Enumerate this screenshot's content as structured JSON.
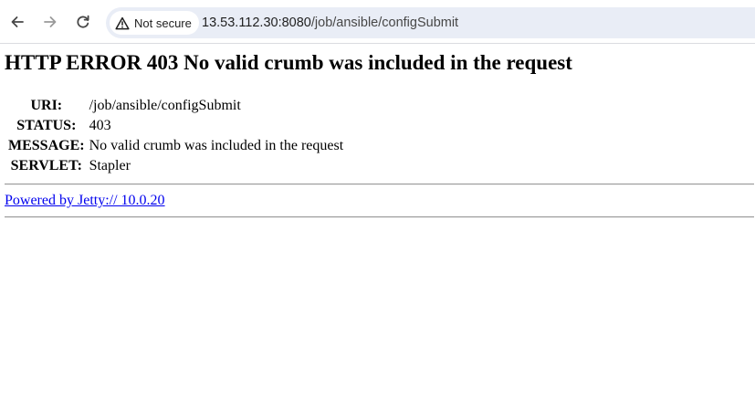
{
  "browser": {
    "back_icon": "arrow-left-icon",
    "forward_icon": "arrow-right-icon",
    "reload_icon": "reload-icon",
    "security_icon": "warning-triangle-icon",
    "security_label": "Not secure",
    "url_host": "13.53.112.30:8080",
    "url_path": "/job/ansible/configSubmit"
  },
  "page": {
    "title": "HTTP ERROR 403 No valid crumb was included in the request",
    "rows": [
      {
        "label": "URI:",
        "value": "/job/ansible/configSubmit"
      },
      {
        "label": "STATUS:",
        "value": "403"
      },
      {
        "label": "MESSAGE:",
        "value": "No valid crumb was included in the request"
      },
      {
        "label": "SERVLET:",
        "value": "Stapler"
      }
    ],
    "footer_link": "Powered by Jetty:// 10.0.20"
  },
  "colors": {
    "link": "#0000ee",
    "omnibox_bg": "#e9edf6"
  }
}
